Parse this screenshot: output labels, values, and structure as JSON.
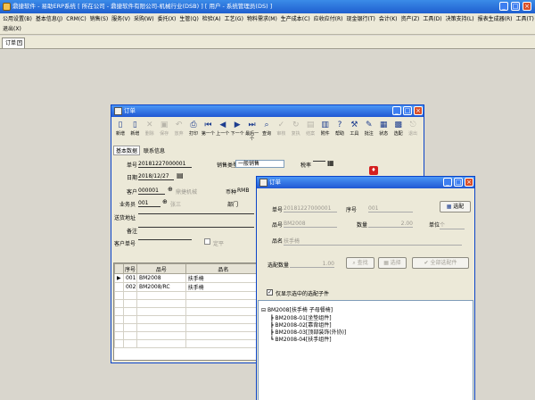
{
  "app": {
    "title": "鼎捷软件 - 易助ERP系统    [ 所在公司 - 鼎捷软件有限公司-机械行业(DSB) ]    [ 用户 - 系统管理员(DS) ]"
  },
  "menu": {
    "row1": [
      "公用设置(B)",
      "基本信息(J)",
      "CRM(C)",
      "销售(S)",
      "服务(V)",
      "采购(W)",
      "委托(X)",
      "生管(Q)",
      "检验(A)",
      "工艺(G)",
      "物料需求(M)",
      "生产成本(C)",
      "应收应付(R)",
      "现金银行(T)",
      "会计(K)",
      "资产(Z)",
      "工具(D)",
      "决策支持(L)",
      "报表生成器(R)",
      "工具(T)",
      "窗口(W)"
    ],
    "row2": [
      "退出(X)"
    ]
  },
  "tab_strip": {
    "tab_label": "订单"
  },
  "order_window": {
    "title": "订单",
    "toolbar": [
      {
        "label": "新增",
        "icon": "new-icon",
        "enabled": true
      },
      {
        "label": "新增",
        "icon": "copy-icon",
        "enabled": true
      },
      {
        "label": "删除",
        "icon": "delete-icon",
        "enabled": false
      },
      {
        "label": "保存",
        "icon": "save-icon",
        "enabled": false
      },
      {
        "label": "放弃",
        "icon": "undo-icon",
        "enabled": false
      },
      {
        "label": "打印",
        "icon": "print-icon",
        "enabled": true
      },
      {
        "label": "第一个",
        "icon": "first-icon",
        "enabled": true
      },
      {
        "label": "上一个",
        "icon": "prev-icon",
        "enabled": true
      },
      {
        "label": "下一个",
        "icon": "next-icon",
        "enabled": true
      },
      {
        "label": "最后一个",
        "icon": "last-icon",
        "enabled": true
      },
      {
        "label": "查询",
        "icon": "query-icon",
        "enabled": true
      },
      {
        "label": "审核",
        "icon": "audit-icon",
        "enabled": false
      },
      {
        "label": "复执",
        "icon": "reexec-icon",
        "enabled": false
      },
      {
        "label": "结案",
        "icon": "close-case-icon",
        "enabled": false
      },
      {
        "label": "附件",
        "icon": "attach-icon",
        "enabled": true
      },
      {
        "label": "帮助",
        "icon": "help-icon",
        "enabled": true
      },
      {
        "label": "工具",
        "icon": "tools-icon",
        "enabled": true
      },
      {
        "label": "批注",
        "icon": "note-icon",
        "enabled": true
      },
      {
        "label": "状态",
        "icon": "status-icon",
        "enabled": true
      },
      {
        "label": "选配",
        "icon": "config-icon",
        "enabled": true
      },
      {
        "label": "退出",
        "icon": "exit-icon",
        "enabled": false
      }
    ],
    "subtabs": [
      "基本数据",
      "联系信息"
    ],
    "fields": {
      "order_no_label": "单号",
      "order_no": "20181227000001",
      "date_label": "日期",
      "date": "2018/12/27",
      "customer_label": "客户",
      "customer": "000001",
      "customer_name": "鼎捷机械",
      "sales_label": "业务员",
      "sales": "001",
      "sales_name": "张三",
      "shipto_label": "送货地址",
      "remark_label": "备注",
      "cust_po_label": "客户单号",
      "sale_type_label": "销售类型",
      "sale_type": "一般销售",
      "tax_label": "税率",
      "currency_label": "币种",
      "currency": "RMB",
      "dept_label": "部门",
      "checkbox_label": "定平"
    },
    "grid": {
      "headers": [
        "序号",
        "品号",
        "品名"
      ],
      "rows": [
        {
          "seq": "001",
          "item": "BM2008",
          "name": "扶手椅"
        },
        {
          "seq": "002",
          "item": "BM2008/RC",
          "name": "扶手椅"
        }
      ]
    }
  },
  "config_window": {
    "title": "订单",
    "fields": {
      "order_no_label": "单号",
      "order_no": "20181227000001",
      "seq_label": "序号",
      "seq": "001",
      "item_label": "品号",
      "item": "BM2008",
      "qty_label": "数量",
      "qty": "2.00",
      "unit_label": "单位",
      "unit": "个",
      "name_label": "品名",
      "name": "扶手椅",
      "config_qty_label": "选配数量",
      "config_qty": "1.00"
    },
    "buttons": {
      "top_right": "选配",
      "b1": "查找",
      "b2": "选择",
      "b3": "全部选配件"
    },
    "checkbox_label": "仅显示选中的选配子件",
    "tree": [
      "BM2008[扶手椅 子母餐椅]",
      "BM2008-01[坐垫组件]",
      "BM2008-02[靠背组件]",
      "BM2008-03[顶部装饰(外协)]",
      "BM2008-04[扶手组件]"
    ]
  }
}
